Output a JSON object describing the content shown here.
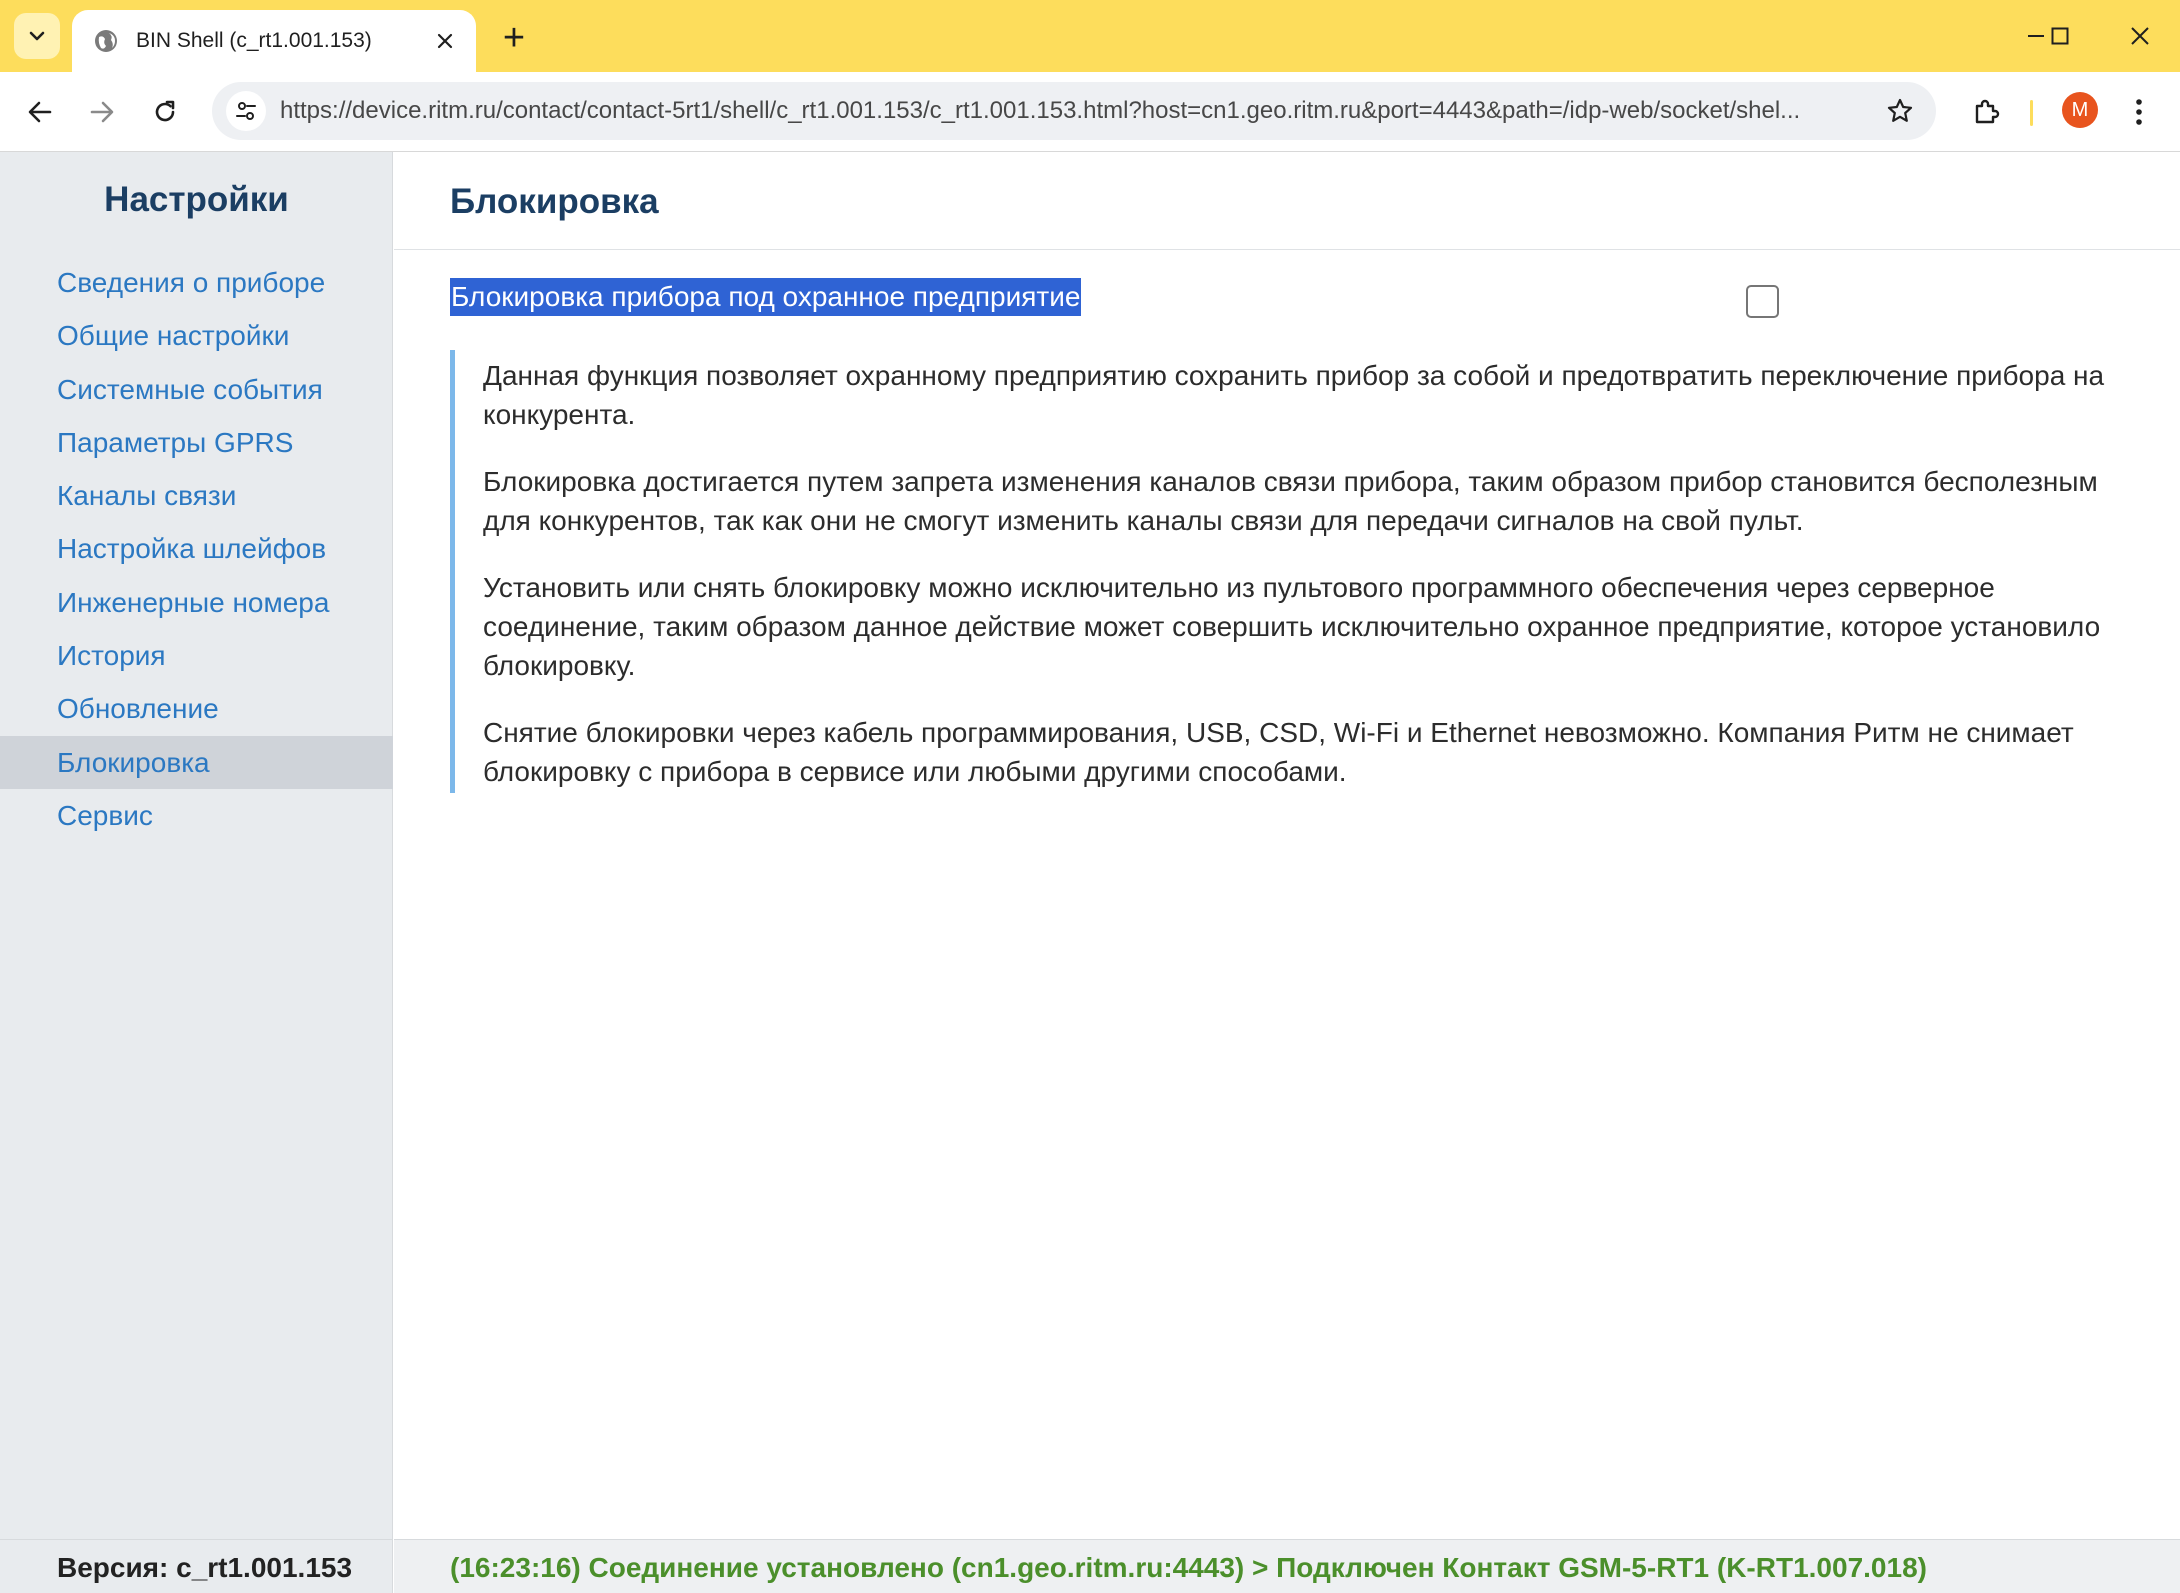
{
  "browser": {
    "tab_title": "BIN Shell (c_rt1.001.153)",
    "new_tab_symbol": "+",
    "url": "https://device.ritm.ru/contact/contact-5rt1/shell/c_rt1.001.153/c_rt1.001.153.html?host=cn1.geo.ritm.ru&port=4443&path=/idp-web/socket/shel...",
    "profile_initial": "M",
    "accent_color": "#fddd5c",
    "icons": [
      "tab-search-icon",
      "globe-icon",
      "close-icon",
      "minimize-icon",
      "maximize-icon",
      "window-close-icon",
      "back-icon",
      "forward-icon",
      "reload-icon",
      "site-info-icon",
      "bookmark-star-icon",
      "extensions-icon",
      "kebab-menu-icon"
    ]
  },
  "sidebar": {
    "title": "Настройки",
    "items": [
      {
        "label": "Сведения о приборе"
      },
      {
        "label": "Общие настройки"
      },
      {
        "label": "Системные события"
      },
      {
        "label": "Параметры GPRS"
      },
      {
        "label": "Каналы связи"
      },
      {
        "label": "Настройка шлейфов"
      },
      {
        "label": "Инженерные номера"
      },
      {
        "label": "История"
      },
      {
        "label": "Обновление"
      },
      {
        "label": "Блокировка"
      },
      {
        "label": "Сервис"
      }
    ],
    "active_item": "Блокировка",
    "version": "Версия: c_rt1.001.153"
  },
  "main": {
    "title": "Блокировка",
    "lock_label": "Блокировка прибора под охранное предприятие",
    "lock_checked": false,
    "paragraphs": [
      "Данная функция позволяет охранному предприятию сохранить прибор за собой и предотвратить переключение прибора на конкурента.",
      "Блокировка достигается путем запрета изменения каналов связи прибора, таким образом прибор становится бесполезным для конкурентов, так как они не смогут изменить каналы связи для передачи сигналов на свой пульт.",
      "Установить или снять блокировку можно исключительно из пультового программного обеспечения через серверное соединение, таким образом данное действие может совершить исключительно охранное предприятие, которое установило блокировку.",
      "Снятие блокировки через кабель программирования, USB, CSD, Wi-Fi и Ethernet невозможно. Компания Ритм не снимает блокировку с прибора в сервисе или любыми другими способами."
    ]
  },
  "status_bar": {
    "text": "(16:23:16) Соединение установлено (cn1.geo.ritm.ru:4443) > Подключен Контакт GSM-5-RT1 (K-RT1.007.018)",
    "color": "#4b8f2b"
  }
}
